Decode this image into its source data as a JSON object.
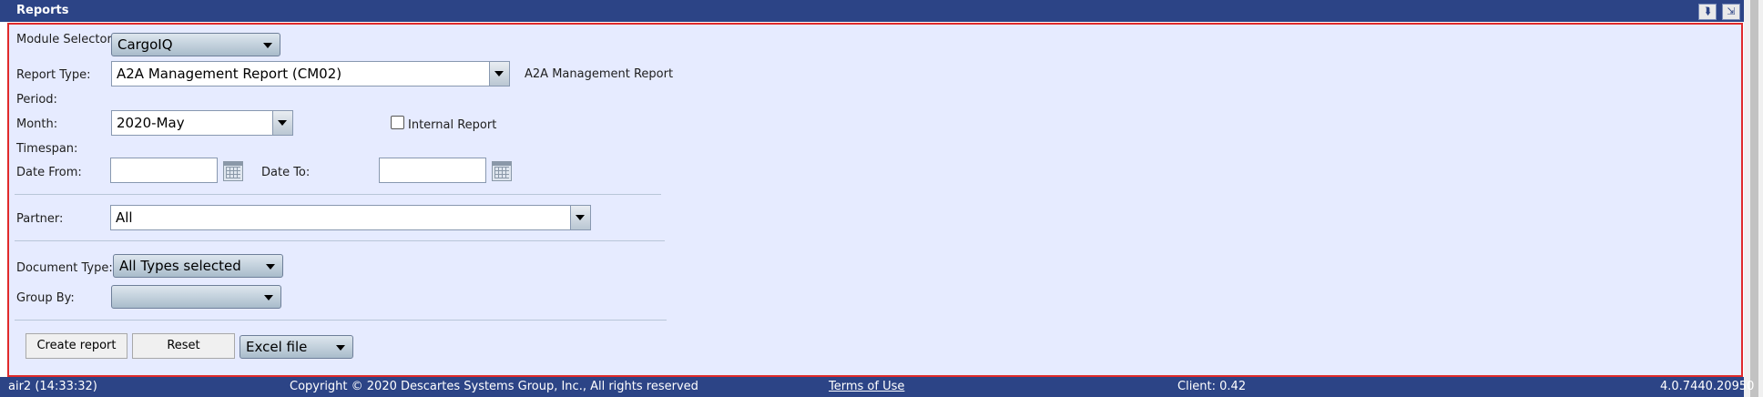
{
  "header": {
    "title": "Reports",
    "collapse_icon": "double-chevron-down-icon",
    "popout_icon": "popout-window-icon"
  },
  "form": {
    "module_selector": {
      "label": "Module Selector:",
      "value": "CargoIQ"
    },
    "report_type": {
      "label": "Report Type:",
      "value": "A2A Management Report (CM02)",
      "description": "A2A Management Report"
    },
    "period": {
      "label": "Period:"
    },
    "month": {
      "label": "Month:",
      "value": "2020-May"
    },
    "internal_report": {
      "label": "Internal Report",
      "checked": false
    },
    "timespan": {
      "label": "Timespan:"
    },
    "date_from": {
      "label": "Date From:",
      "value": ""
    },
    "date_to": {
      "label": "Date To:",
      "value": ""
    },
    "partner": {
      "label": "Partner:",
      "value": "All"
    },
    "document_type": {
      "label": "Document Type:",
      "value": "All Types selected"
    },
    "group_by": {
      "label": "Group By:",
      "value": ""
    }
  },
  "actions": {
    "create_label": "Create report",
    "reset_label": "Reset",
    "format_value": "Excel file"
  },
  "footer": {
    "session": "air2 (14:33:32)",
    "copyright": "Copyright © 2020 Descartes Systems Group, Inc., All rights reserved",
    "terms": "Terms of Use",
    "client": "Client: 0.42",
    "version": "4.0.7440.20950"
  },
  "colors": {
    "header_bg": "#2c4486",
    "panel_bg": "#e6ebff",
    "panel_border": "#e02a2a"
  }
}
